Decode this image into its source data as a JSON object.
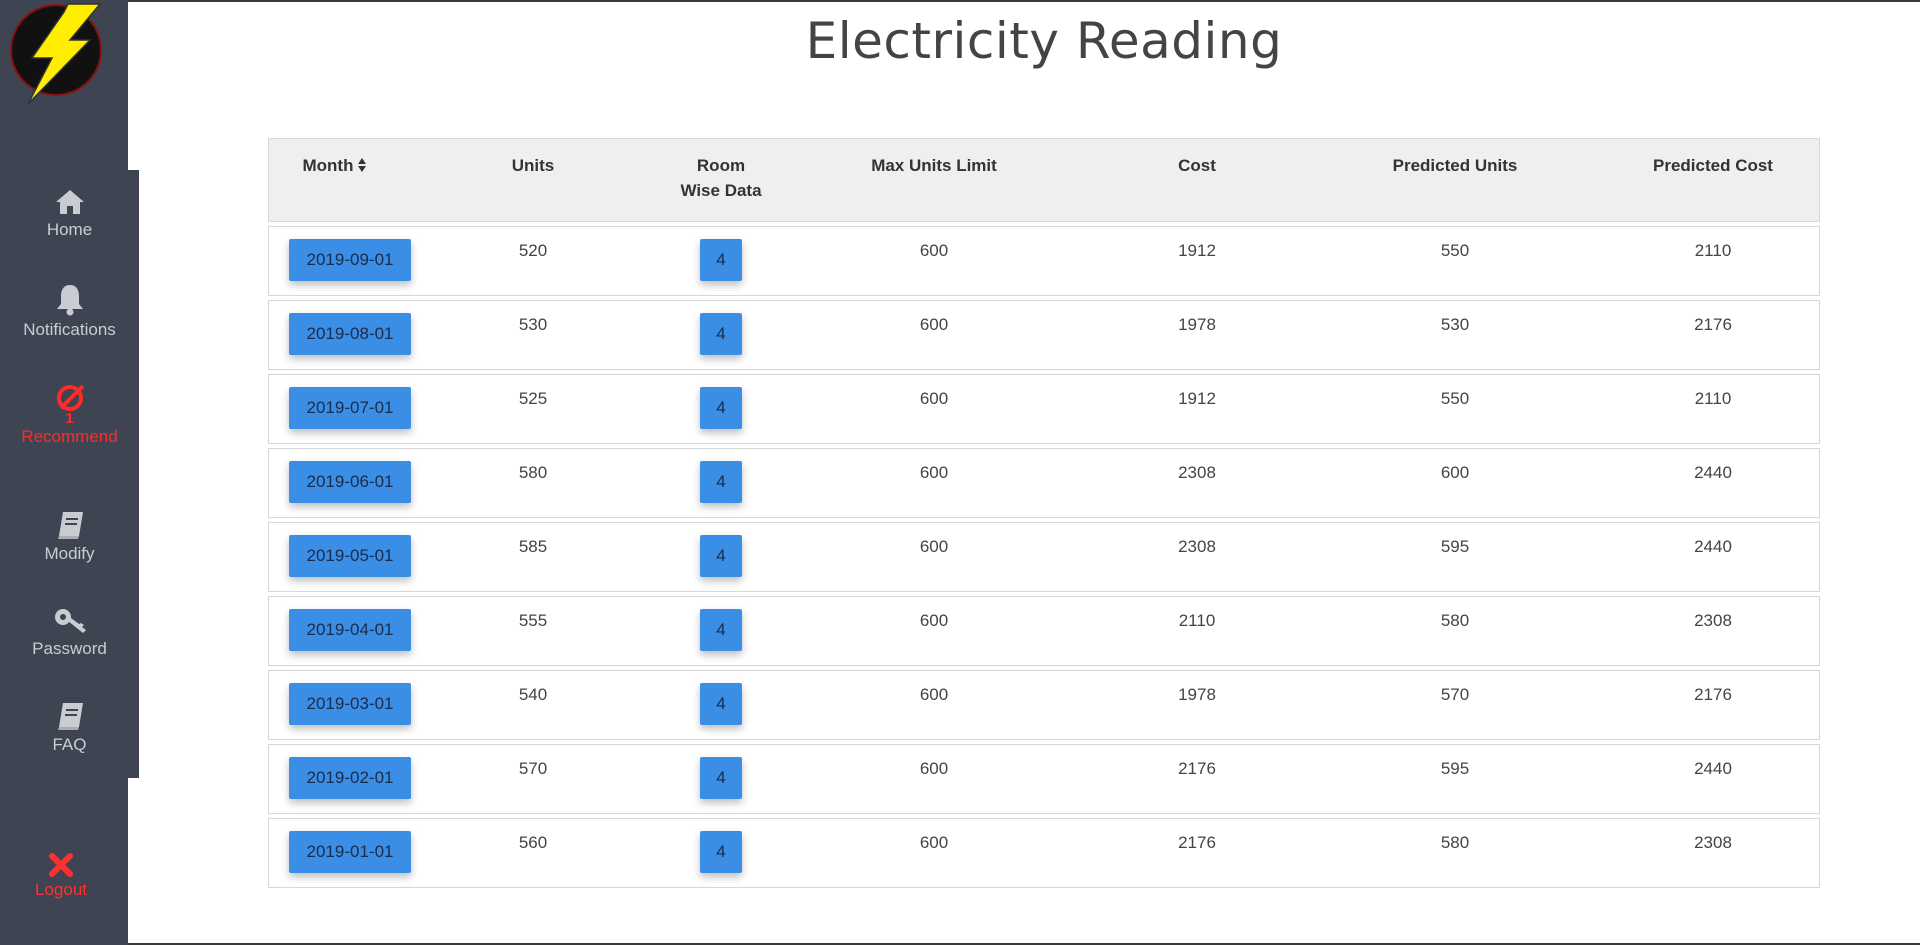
{
  "page": {
    "title": "Electricity Reading"
  },
  "sidebar": {
    "items": [
      {
        "label": "Home",
        "icon": "home-icon"
      },
      {
        "label": "Notifications",
        "icon": "bell-icon"
      },
      {
        "label": "Recommend",
        "icon": "recommend-icon",
        "badge": "1",
        "active": true
      },
      {
        "label": "Modify",
        "icon": "book-icon"
      },
      {
        "label": "Password",
        "icon": "key-icon"
      },
      {
        "label": "FAQ",
        "icon": "book-icon"
      }
    ],
    "logout": {
      "label": "Logout",
      "icon": "close-icon"
    },
    "colors": {
      "background": "#3e4452",
      "active": "#ff2a2a",
      "logo_bolt": "#ffee00"
    }
  },
  "table": {
    "headers": {
      "month": "Month",
      "units": "Units",
      "room_line1": "Room",
      "room_line2": "Wise Data",
      "max_units": "Max Units Limit",
      "cost": "Cost",
      "predicted_units": "Predicted Units",
      "predicted_cost": "Predicted Cost"
    },
    "rows": [
      {
        "month": "2019-09-01",
        "units": "520",
        "room": "4",
        "max": "600",
        "cost": "1912",
        "pred_units": "550",
        "pred_cost": "2110"
      },
      {
        "month": "2019-08-01",
        "units": "530",
        "room": "4",
        "max": "600",
        "cost": "1978",
        "pred_units": "530",
        "pred_cost": "2176"
      },
      {
        "month": "2019-07-01",
        "units": "525",
        "room": "4",
        "max": "600",
        "cost": "1912",
        "pred_units": "550",
        "pred_cost": "2110"
      },
      {
        "month": "2019-06-01",
        "units": "580",
        "room": "4",
        "max": "600",
        "cost": "2308",
        "pred_units": "600",
        "pred_cost": "2440"
      },
      {
        "month": "2019-05-01",
        "units": "585",
        "room": "4",
        "max": "600",
        "cost": "2308",
        "pred_units": "595",
        "pred_cost": "2440"
      },
      {
        "month": "2019-04-01",
        "units": "555",
        "room": "4",
        "max": "600",
        "cost": "2110",
        "pred_units": "580",
        "pred_cost": "2308"
      },
      {
        "month": "2019-03-01",
        "units": "540",
        "room": "4",
        "max": "600",
        "cost": "1978",
        "pred_units": "570",
        "pred_cost": "2176"
      },
      {
        "month": "2019-02-01",
        "units": "570",
        "room": "4",
        "max": "600",
        "cost": "2176",
        "pred_units": "595",
        "pred_cost": "2440"
      },
      {
        "month": "2019-01-01",
        "units": "560",
        "room": "4",
        "max": "600",
        "cost": "2176",
        "pred_units": "580",
        "pred_cost": "2308"
      }
    ],
    "button_color": "#3a8ee6"
  }
}
